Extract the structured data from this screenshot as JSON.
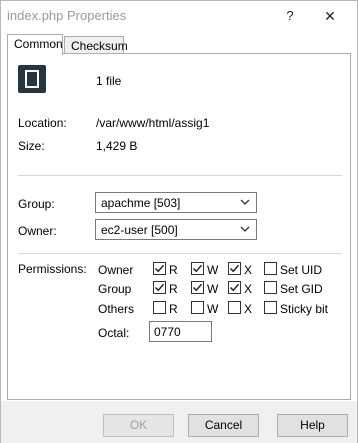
{
  "window": {
    "title": "index.php Properties",
    "help_glyph": "?",
    "close_glyph": "✕"
  },
  "tabs": [
    {
      "label": "Common",
      "active": true
    },
    {
      "label": "Checksum",
      "active": false
    }
  ],
  "file": {
    "icon": "file-bracket-icon",
    "count_text": "1 file",
    "location_label": "Location:",
    "location_value": "/var/www/html/assig1",
    "size_label": "Size:",
    "size_value": "1,429 B"
  },
  "ownership": {
    "group_label": "Group:",
    "group_value": "apachme [503]",
    "owner_label": "Owner:",
    "owner_value": "ec2-user [500]"
  },
  "permissions": {
    "label": "Permissions:",
    "rows": [
      {
        "label": "Owner",
        "r": true,
        "w": true,
        "x": true,
        "special_label": "Set UID",
        "special": false
      },
      {
        "label": "Group",
        "r": true,
        "w": true,
        "x": true,
        "special_label": "Set GID",
        "special": false
      },
      {
        "label": "Others",
        "r": false,
        "w": false,
        "x": false,
        "special_label": "Sticky bit",
        "special": false
      }
    ],
    "r_label": "R",
    "w_label": "W",
    "x_label": "X",
    "octal_label": "Octal:",
    "octal_value": "0770"
  },
  "buttons": {
    "ok": "OK",
    "cancel": "Cancel",
    "help": "Help"
  }
}
